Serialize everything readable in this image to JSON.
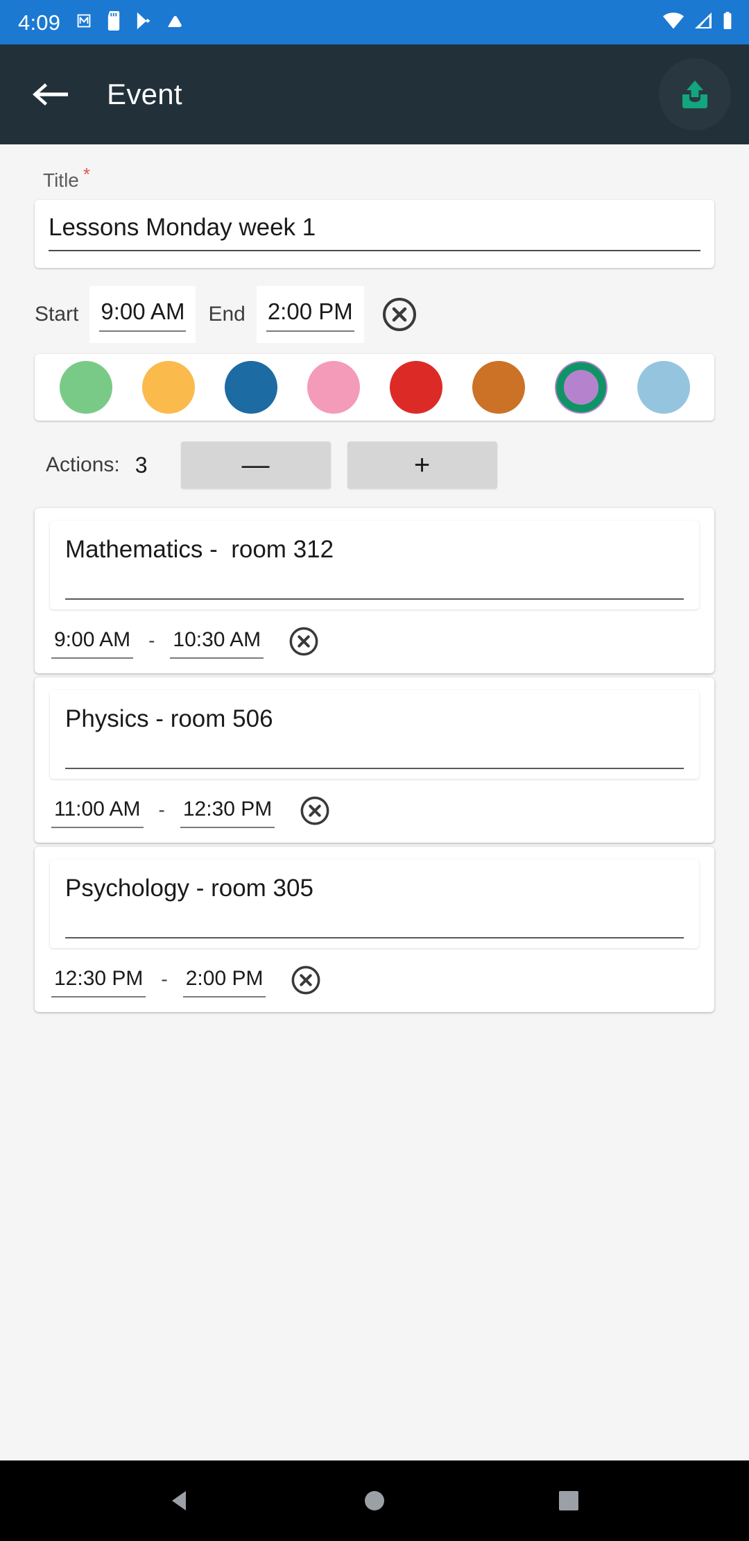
{
  "status_bar": {
    "time": "4:09",
    "left_icons": [
      "gmail-icon",
      "sd-card-icon",
      "play-store-icon",
      "cloud-icon"
    ],
    "right_icons": [
      "wifi-icon",
      "cell-signal-icon",
      "battery-icon"
    ],
    "background_color": "#1B79D2"
  },
  "toolbar": {
    "back_label": "back-arrow",
    "title": "Event",
    "save_label": "save-upload",
    "background_color": "#22303A",
    "save_color": "#13A57D"
  },
  "form": {
    "title_label": "Title",
    "required_marker": "*",
    "title_value": "Lessons Monday week 1",
    "title_placeholder": "Title",
    "start_label": "Start",
    "start_value": "9:00 AM",
    "end_label": "End",
    "end_value": "2:00 PM",
    "clear_times_label": "clear-times"
  },
  "palette": {
    "swatches": [
      {
        "color": "#7ACA87",
        "selected": false
      },
      {
        "color": "#FBBA4C",
        "selected": false
      },
      {
        "color": "#1D6BA3",
        "selected": false
      },
      {
        "color": "#F49BB9",
        "selected": false
      },
      {
        "color": "#DC2B27",
        "selected": false
      },
      {
        "color": "#CB7226",
        "selected": false
      },
      {
        "color": "#B583CE",
        "selected": true
      },
      {
        "color": "#95C5DE",
        "selected": false
      }
    ],
    "selection_ring_color": "#109466"
  },
  "actions": {
    "label": "Actions:",
    "count": "3",
    "decrement_label": "—",
    "increment_label": "+",
    "items": [
      {
        "name": "Mathematics -  room 312",
        "start": "9:00 AM",
        "separator": "-",
        "end": "10:30 AM",
        "delete_label": "delete-action"
      },
      {
        "name": "Physics - room 506",
        "start": "11:00 AM",
        "separator": "-",
        "end": "12:30 PM",
        "delete_label": "delete-action"
      },
      {
        "name": "Psychology - room 305",
        "start": "12:30 PM",
        "separator": "-",
        "end": "2:00 PM",
        "delete_label": "delete-action"
      }
    ]
  },
  "nav_bar": {
    "back": "nav-back-triangle",
    "home": "nav-home-circle",
    "recents": "nav-recents-square",
    "background_color": "#000000"
  }
}
